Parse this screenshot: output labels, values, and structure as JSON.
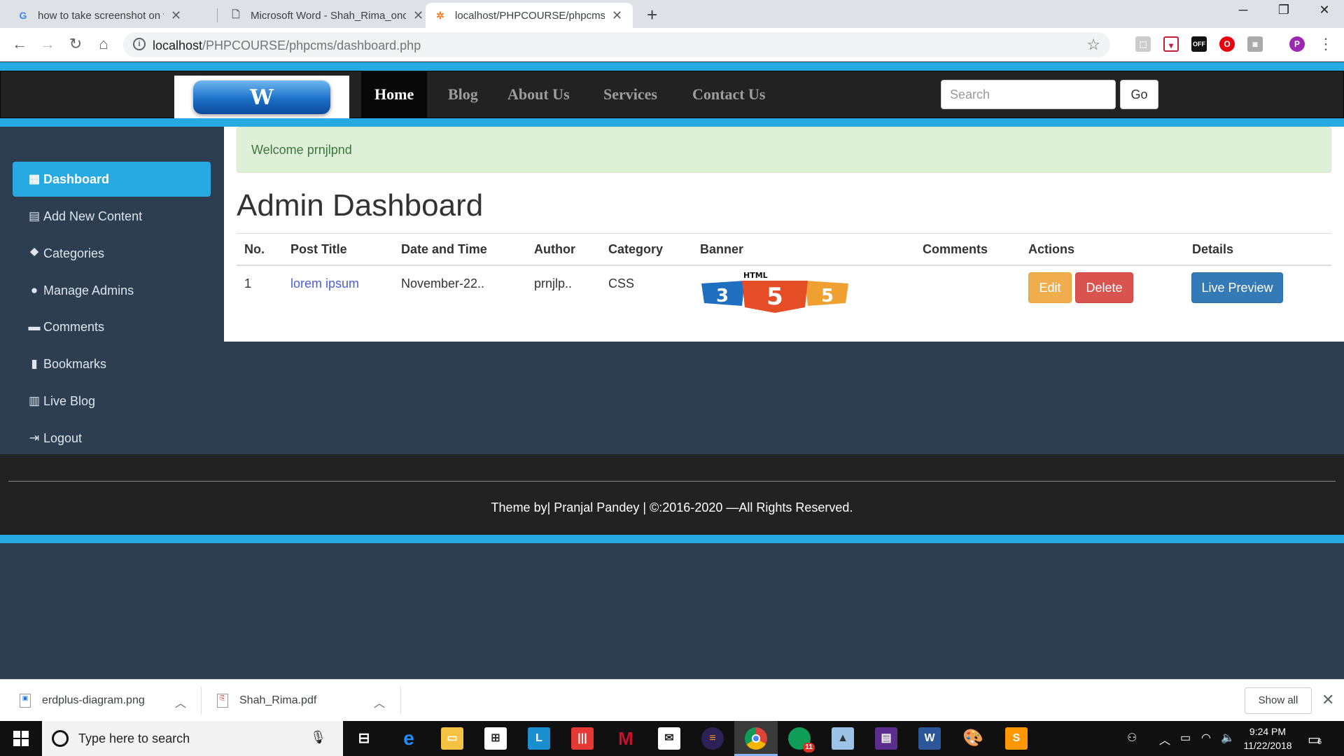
{
  "browser": {
    "tabs": [
      {
        "title": "how to take screenshot on windo",
        "favicon": "G"
      },
      {
        "title": "Microsoft Word - Shah_Rima_onc",
        "favicon": "doc"
      },
      {
        "title": "localhost/PHPCOURSE/phpcms/d",
        "favicon": "xampp"
      }
    ],
    "new_tab": "+",
    "window_controls": {
      "minimize": "─",
      "maximize": "❐",
      "close": "✕"
    },
    "url_host": "localhost",
    "url_path": "/PHPCOURSE/phpcms/dashboard.php",
    "profile_initial": "P"
  },
  "site": {
    "logo_text": "W",
    "nav": [
      "Home",
      "Blog",
      "About Us",
      "Services",
      "Contact Us"
    ],
    "search_placeholder": "Search",
    "go_label": "Go",
    "colors": {
      "accent": "#27aae1",
      "navbar": "#222222",
      "sidebar": "#2c3e50"
    }
  },
  "sidebar": {
    "items": [
      {
        "label": "Dashboard",
        "icon": "th-icon"
      },
      {
        "label": "Add New Content",
        "icon": "list-alt-icon"
      },
      {
        "label": "Categories",
        "icon": "tags-icon"
      },
      {
        "label": "Manage Admins",
        "icon": "user-icon"
      },
      {
        "label": "Comments",
        "icon": "comment-icon"
      },
      {
        "label": "Bookmarks",
        "icon": "bookmark-icon"
      },
      {
        "label": "Live Blog",
        "icon": "equalizer-icon"
      },
      {
        "label": "Logout",
        "icon": "log-out-icon"
      }
    ]
  },
  "main": {
    "welcome": "Welcome prnjlpnd",
    "title": "Admin Dashboard",
    "table": {
      "headers": [
        "No.",
        "Post Title",
        "Date and Time",
        "Author",
        "Category",
        "Banner",
        "Comments",
        "Actions",
        "Details"
      ],
      "rows": [
        {
          "no": "1",
          "title": "lorem ipsum",
          "date": "November-22..",
          "author": "prnjlp..",
          "category": "CSS",
          "banner_text": "HTML",
          "actions": {
            "edit": "Edit",
            "delete": "Delete"
          },
          "details": "Live Preview"
        }
      ]
    }
  },
  "footer": {
    "text": "Theme by| Pranjal Pandey | ©:2016-2020 —All Rights Reserved."
  },
  "downloads": {
    "items": [
      "erdplus-diagram.png",
      "Shah_Rima.pdf"
    ],
    "show_all": "Show all"
  },
  "taskbar": {
    "search_placeholder": "Type here to search",
    "time": "9:24 PM",
    "date": "11/22/2018",
    "notification_count": "6",
    "badge_count": "11"
  }
}
